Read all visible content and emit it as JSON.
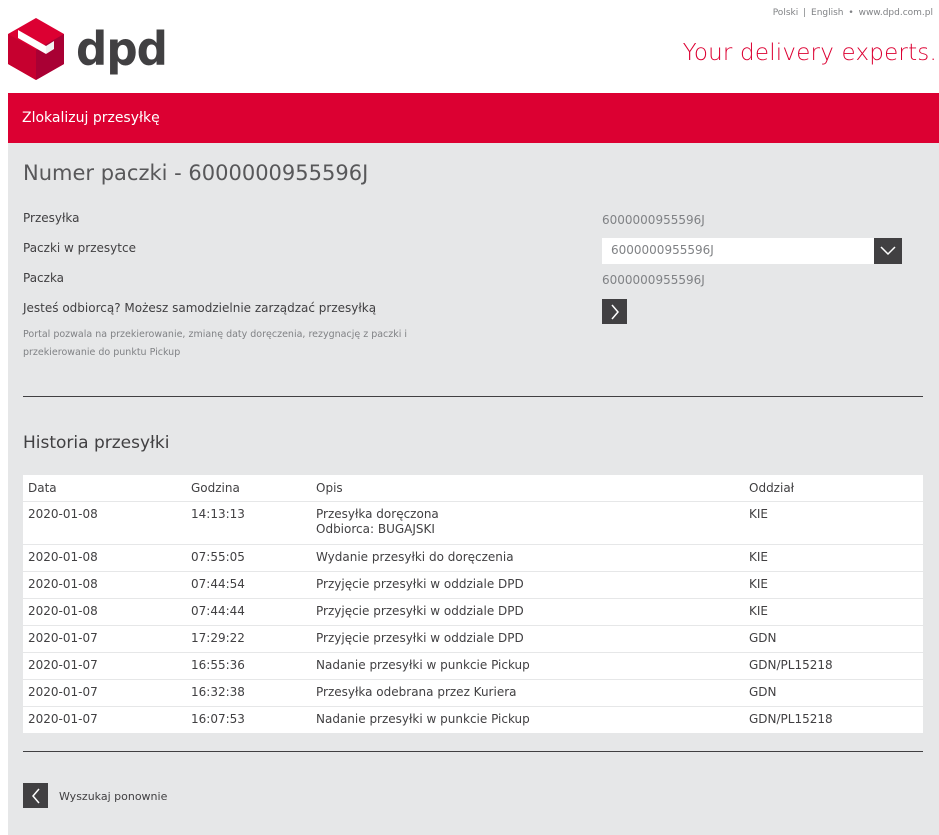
{
  "header": {
    "lang_polish": "Polski",
    "lang_separator": "|",
    "lang_english": "English",
    "dot": "•",
    "site_url": "www.dpd.com.pl",
    "logo_text": "dpd",
    "tagline": "Your delivery experts.",
    "brand_color": "#dc0032"
  },
  "nav": {
    "section_label": "Zlokalizuj przesyłkę"
  },
  "parcel": {
    "title": "Numer paczki - 6000000955596J",
    "shipment_label": "Przesyłka",
    "shipment_value": "6000000955596J",
    "packages_label": "Paczki w przesytce",
    "packages_selected": "6000000955596J",
    "package_label": "Paczka",
    "package_value": "6000000955596J",
    "recipient_label": "Jesteś odbiorcą? Możesz samodzielnie zarządzać przesyłką",
    "note": "Portal pozwala na przekierowanie, zmianę daty doręczenia, rezygnację z paczki i przekierowanie do punktu Pickup"
  },
  "history": {
    "title": "Historia przesyłki",
    "columns": [
      "Data",
      "Godzina",
      "Opis",
      "Oddział"
    ],
    "rows": [
      {
        "date": "2020-01-08",
        "time": "14:13:13",
        "desc": "Przesyłka doręczona",
        "desc2": "Odbiorca: BUGAJSKI",
        "branch": "KIE"
      },
      {
        "date": "2020-01-08",
        "time": "07:55:05",
        "desc": "Wydanie przesyłki do doręczenia",
        "branch": "KIE"
      },
      {
        "date": "2020-01-08",
        "time": "07:44:54",
        "desc": "Przyjęcie przesyłki w oddziale DPD",
        "branch": "KIE"
      },
      {
        "date": "2020-01-08",
        "time": "07:44:44",
        "desc": "Przyjęcie przesyłki w oddziale DPD",
        "branch": "KIE"
      },
      {
        "date": "2020-01-07",
        "time": "17:29:22",
        "desc": "Przyjęcie przesyłki w oddziale DPD",
        "branch": "GDN"
      },
      {
        "date": "2020-01-07",
        "time": "16:55:36",
        "desc": "Nadanie przesyłki w punkcie Pickup",
        "branch": "GDN/PL15218"
      },
      {
        "date": "2020-01-07",
        "time": "16:32:38",
        "desc": "Przesyłka odebrana przez Kuriera",
        "branch": "GDN"
      },
      {
        "date": "2020-01-07",
        "time": "16:07:53",
        "desc": "Nadanie przesyłki w punkcie Pickup",
        "branch": "GDN/PL15218"
      }
    ]
  },
  "footer": {
    "search_again": "Wyszukaj ponownie"
  },
  "icons": {
    "logo": "dpd-cube-logo",
    "dropdown": "chevron-down-icon",
    "manage": "chevron-right-icon",
    "back": "chevron-left-icon"
  }
}
